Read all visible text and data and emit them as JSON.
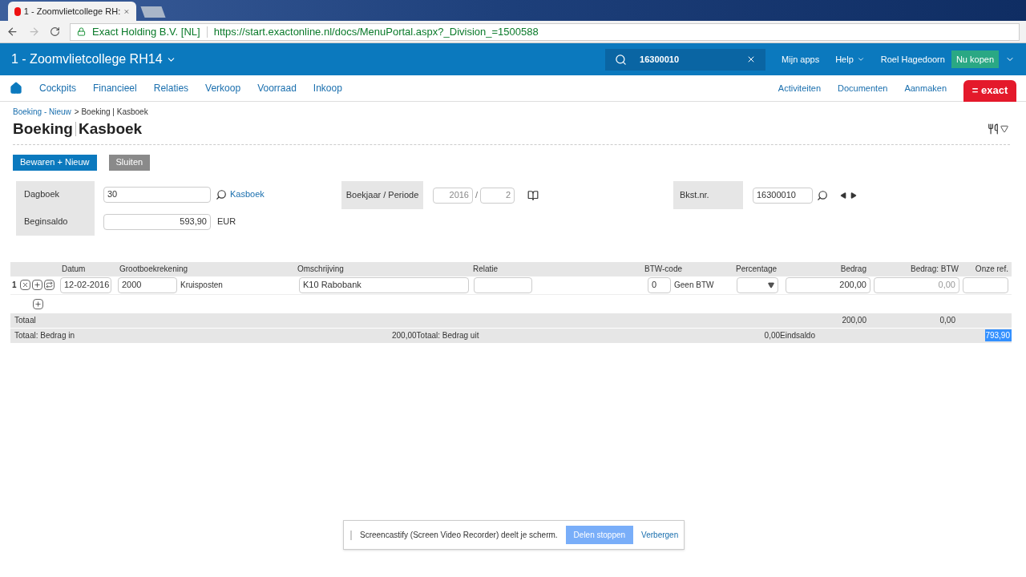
{
  "browser": {
    "tab_title": "1 - Zoomvlietcollege RH:",
    "site_name": "Exact Holding B.V. [NL]",
    "url": "https://start.exactonline.nl/docs/MenuPortal.aspx?_Division_=1500588"
  },
  "header": {
    "company": "1 - Zoomvlietcollege RH14",
    "search_value": "16300010",
    "links": [
      "Mijn apps",
      "Help",
      "Roel Hagedoorn"
    ],
    "buy_button": "Nu kopen"
  },
  "nav": {
    "items": [
      "Cockpits",
      "Financieel",
      "Relaties",
      "Verkoop",
      "Voorraad",
      "Inkoop"
    ],
    "right_items": [
      "Activiteiten",
      "Documenten",
      "Aanmaken"
    ],
    "logo": "= exact"
  },
  "breadcrumb": {
    "link": "Boeking - Nieuw",
    "rest": "> Boeking | Kasboek"
  },
  "title": {
    "main": "Boeking",
    "sub": "Kasboek"
  },
  "buttons": [
    {
      "label": "Bewaren + Nieuw",
      "kind": "primary"
    },
    {
      "label": "Sluiten",
      "kind": "secondary"
    }
  ],
  "form": {
    "dagboek_label": "Dagboek",
    "dagboek_value": "30",
    "dagboek_link": "Kasboek",
    "beginsaldo_label": "Beginsaldo",
    "beginsaldo_value": "593,90",
    "currency": "EUR",
    "period_label": "Boekjaar / Periode",
    "year": "2016",
    "separator": "/",
    "period": "2",
    "bkst_label": "Bkst.nr.",
    "bkst_value": "16300010"
  },
  "table": {
    "columns": [
      "Datum",
      "Grootboekrekening",
      "Omschrijving",
      "Relatie",
      "BTW-code",
      "Percentage",
      "Bedrag",
      "Bedrag: BTW",
      "Onze ref."
    ],
    "rows": [
      {
        "number": "1",
        "date": "12-02-2016",
        "account": "2000",
        "account_name": "Kruisposten",
        "description": "K10 Rabobank",
        "btw_code": "0",
        "btw_name": "Geen BTW",
        "amount": "200,00",
        "btw_amount": "0,00"
      }
    ],
    "total": {
      "label": "Totaal",
      "amount": "200,00",
      "btw_amount": "0,00"
    },
    "summary": {
      "in_label": "Totaal: Bedrag in",
      "in_value": "200,00",
      "out_label": "Totaal: Bedrag uit",
      "out_value": "0,00",
      "end_label": "Eindsaldo",
      "end_value": "793,90"
    }
  },
  "share_bar": {
    "text": "Screencastify (Screen Video Recorder) deelt je scherm.",
    "stop_button": "Delen stoppen",
    "hide_link": "Verbergen"
  }
}
